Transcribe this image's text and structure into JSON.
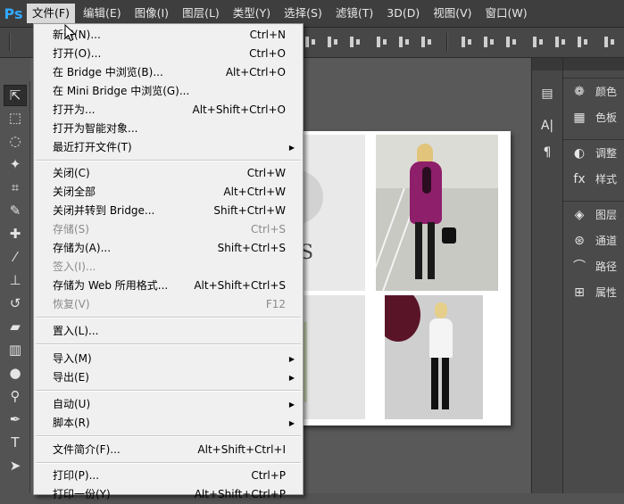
{
  "app": {
    "logo": "Ps"
  },
  "menubar": {
    "items": [
      {
        "label": "文件(F)",
        "active": true
      },
      {
        "label": "编辑(E)"
      },
      {
        "label": "图像(I)"
      },
      {
        "label": "图层(L)"
      },
      {
        "label": "类型(Y)"
      },
      {
        "label": "选择(S)"
      },
      {
        "label": "滤镜(T)"
      },
      {
        "label": "3D(D)"
      },
      {
        "label": "视图(V)"
      },
      {
        "label": "窗口(W)"
      }
    ]
  },
  "file_menu": {
    "items": [
      {
        "label": "新建(N)...",
        "shortcut": "Ctrl+N"
      },
      {
        "label": "打开(O)...",
        "shortcut": "Ctrl+O"
      },
      {
        "label": "在 Bridge 中浏览(B)...",
        "shortcut": "Alt+Ctrl+O"
      },
      {
        "label": "在 Mini Bridge 中浏览(G)...",
        "shortcut": ""
      },
      {
        "label": "打开为...",
        "shortcut": "Alt+Shift+Ctrl+O"
      },
      {
        "label": "打开为智能对象...",
        "shortcut": ""
      },
      {
        "label": "最近打开文件(T)",
        "shortcut": "",
        "submenu": true
      },
      {
        "label": "关闭(C)",
        "shortcut": "Ctrl+W"
      },
      {
        "label": "关闭全部",
        "shortcut": "Alt+Ctrl+W"
      },
      {
        "label": "关闭并转到 Bridge...",
        "shortcut": "Shift+Ctrl+W"
      },
      {
        "label": "存储(S)",
        "shortcut": "Ctrl+S",
        "disabled": true
      },
      {
        "label": "存储为(A)...",
        "shortcut": "Shift+Ctrl+S"
      },
      {
        "label": "签入(I)...",
        "shortcut": "",
        "disabled": true
      },
      {
        "label": "存储为 Web 所用格式...",
        "shortcut": "Alt+Shift+Ctrl+S"
      },
      {
        "label": "恢复(V)",
        "shortcut": "F12",
        "disabled": true
      },
      {
        "label": "置入(L)...",
        "shortcut": ""
      },
      {
        "label": "导入(M)",
        "shortcut": "",
        "submenu": true
      },
      {
        "label": "导出(E)",
        "shortcut": "",
        "submenu": true
      },
      {
        "label": "自动(U)",
        "shortcut": "",
        "submenu": true
      },
      {
        "label": "脚本(R)",
        "shortcut": "",
        "submenu": true
      },
      {
        "label": "文件简介(F)...",
        "shortcut": "Alt+Shift+Ctrl+I"
      },
      {
        "label": "打印(P)...",
        "shortcut": "Ctrl+P"
      },
      {
        "label": "打印一份(Y)",
        "shortcut": "Alt+Shift+Ctrl+P"
      }
    ]
  },
  "panels": {
    "group1": [
      {
        "label": "颜色",
        "icon": "palette-icon"
      },
      {
        "label": "色板",
        "icon": "swatches-icon"
      }
    ],
    "group2": [
      {
        "label": "调整",
        "icon": "adjustments-icon"
      },
      {
        "label": "样式",
        "icon": "styles-icon"
      }
    ],
    "group3": [
      {
        "label": "图层",
        "icon": "layers-icon"
      },
      {
        "label": "通道",
        "icon": "channels-icon"
      },
      {
        "label": "路径",
        "icon": "paths-icon"
      },
      {
        "label": "属性",
        "icon": "properties-icon"
      }
    ]
  },
  "colors": {
    "menubar_bg": "#3e3e3e",
    "menu_bg": "#f0f0f0",
    "accent": "#31a8ff",
    "photo_magenta": "#8e1f6a"
  }
}
